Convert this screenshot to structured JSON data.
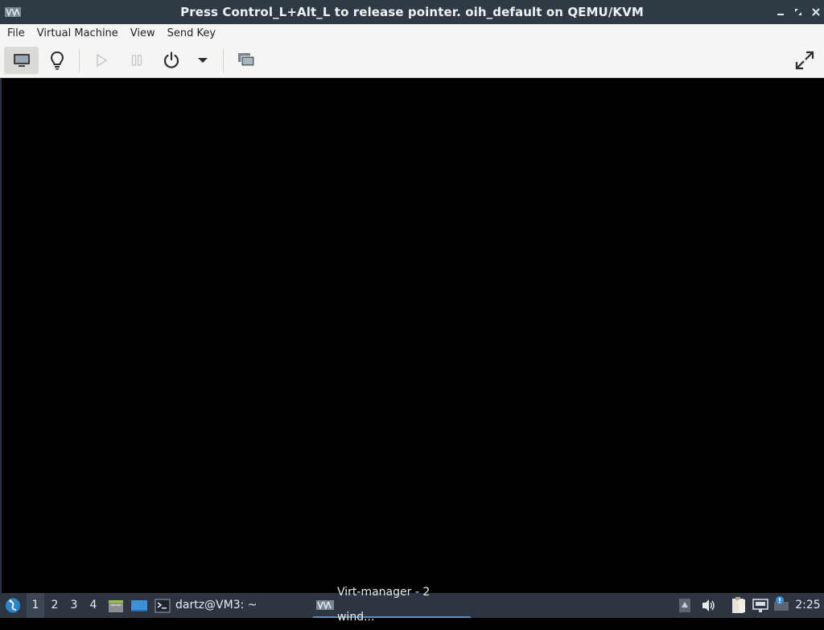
{
  "window": {
    "title": "Press Control_L+Alt_L to release pointer. oih_default on QEMU/KVM",
    "app_icon": "virt-manager-icon",
    "controls": [
      "minimize-icon",
      "maximize-icon",
      "close-icon"
    ]
  },
  "menubar": {
    "items": [
      "File",
      "Virtual Machine",
      "View",
      "Send Key"
    ]
  },
  "toolbar": {
    "buttons": [
      {
        "name": "console-view",
        "icon": "monitor-icon",
        "active": true
      },
      {
        "name": "details-view",
        "icon": "lightbulb-icon"
      },
      {
        "name": "run",
        "icon": "play-icon",
        "disabled": true
      },
      {
        "name": "pause",
        "icon": "pause-icon",
        "disabled": true
      },
      {
        "name": "shutdown",
        "icon": "power-icon"
      },
      {
        "name": "shutdown-menu",
        "icon": "chevron-down-icon"
      },
      {
        "name": "snapshots",
        "icon": "snapshots-icon"
      },
      {
        "name": "fullscreen",
        "icon": "fullscreen-icon"
      }
    ]
  },
  "taskbar": {
    "workspaces": [
      "1",
      "2",
      "3",
      "4"
    ],
    "active_workspace": "1",
    "tasks": [
      {
        "label": "dartz@VM3: ~",
        "icon": "terminal-icon"
      },
      {
        "label": "Virt-manager - 2 wind...",
        "icon": "virt-manager-icon",
        "active": true
      }
    ],
    "clock": "2:25"
  },
  "colors": {
    "titlebar": "#2f3a44",
    "toolbar": "#f6f5f4",
    "taskbar": "#2d3640",
    "accent": "#4a90d9"
  }
}
